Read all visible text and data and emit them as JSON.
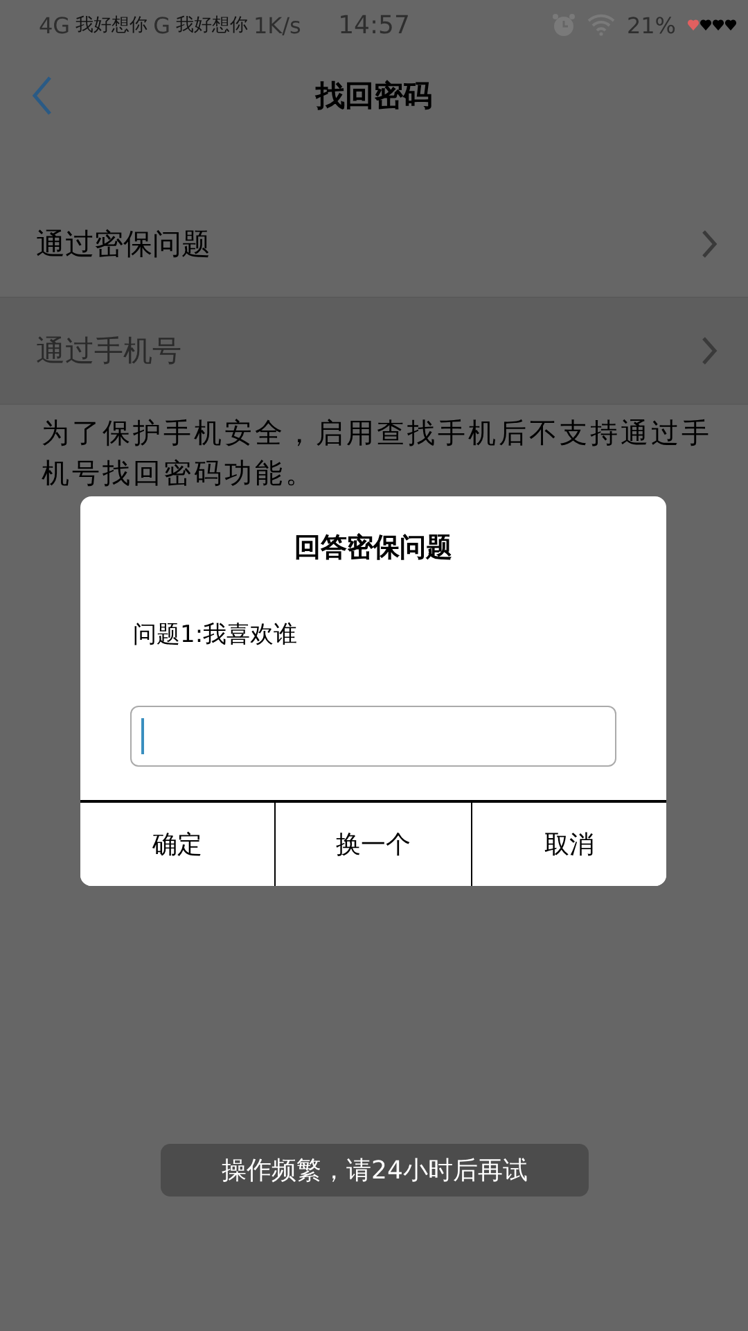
{
  "status_bar": {
    "left": [
      "4G",
      "我好想你",
      "G",
      "我好想你",
      "1K/s"
    ],
    "time": "14:57",
    "battery": "21%"
  },
  "nav": {
    "title": "找回密码"
  },
  "options": [
    {
      "label": "通过密保问题",
      "disabled": false
    },
    {
      "label": "通过手机号",
      "disabled": true
    }
  ],
  "notice": "为了保护手机安全，启用查找手机后不支持通过手机号找回密码功能。",
  "dialog": {
    "title": "回答密保问题",
    "question": "问题1:我喜欢谁",
    "answer": {
      "focused": true
    },
    "buttons": [
      "确定",
      "换一个",
      "取消"
    ]
  },
  "toast": "操作频繁，请24小时后再试"
}
